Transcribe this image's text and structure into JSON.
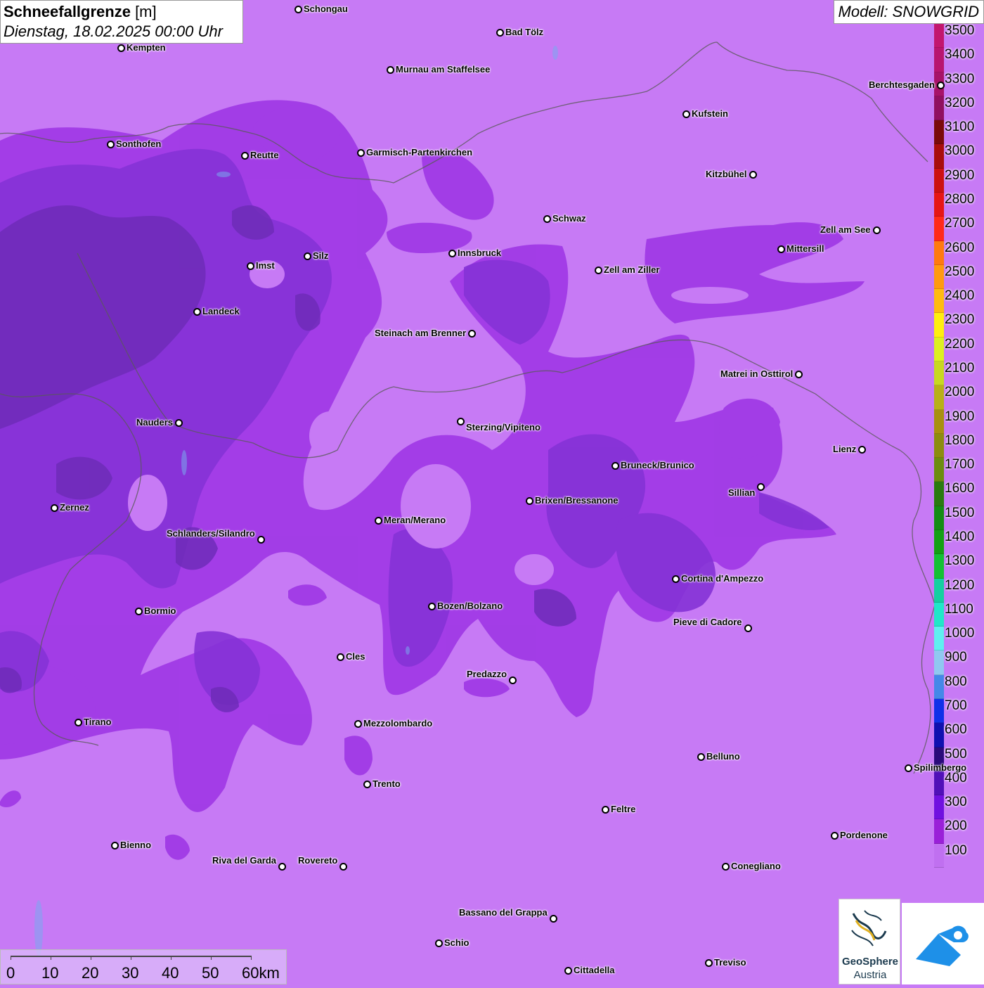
{
  "header": {
    "title_bold": "Schneefallgrenze",
    "title_unit": " [m]",
    "datetime": "Dienstag, 18.02.2025 00:00 Uhr",
    "model": "Modell: SNOWGRID"
  },
  "legend": {
    "labels": [
      "3500",
      "3400",
      "3300",
      "3200",
      "3100",
      "3000",
      "2900",
      "2800",
      "2700",
      "2600",
      "2500",
      "2400",
      "2300",
      "2200",
      "2100",
      "2000",
      "1900",
      "1800",
      "1700",
      "1600",
      "1500",
      "1400",
      "1300",
      "1200",
      "1100",
      "1000",
      "900",
      "800",
      "700",
      "600",
      "500",
      "400",
      "300",
      "200",
      "100"
    ],
    "colors": [
      "#c2166e",
      "#b8156f",
      "#a71368",
      "#901060",
      "#7a0a0a",
      "#a80d0d",
      "#cc1111",
      "#e61616",
      "#ff2a1a",
      "#ff7a10",
      "#ff9a10",
      "#ffbb10",
      "#ffee10",
      "#ddf020",
      "#c8d820",
      "#b8b018",
      "#a89010",
      "#8c8c10",
      "#6c8c10",
      "#2a7a10",
      "#148c14",
      "#14a014",
      "#14c034",
      "#14d0a0",
      "#20e8c8",
      "#60f0f0",
      "#90c8f0",
      "#4488e8",
      "#1030e8",
      "#1010b0",
      "#2a0a7a",
      "#5010b8",
      "#7010e0",
      "#9a20d8",
      "#c070f0"
    ]
  },
  "scale": {
    "labels": [
      "0",
      "10",
      "20",
      "30",
      "40",
      "50",
      "60km"
    ]
  },
  "cities": [
    {
      "name": "Schongau"
    },
    {
      "name": "Bad Tölz"
    },
    {
      "name": "Kempten"
    },
    {
      "name": "Murnau am Staffelsee"
    },
    {
      "name": "Berchtesgaden"
    },
    {
      "name": "Kufstein"
    },
    {
      "name": "Sonthofen"
    },
    {
      "name": "Reutte"
    },
    {
      "name": "Garmisch-Partenkirchen"
    },
    {
      "name": "Kitzbühel"
    },
    {
      "name": "Schwaz"
    },
    {
      "name": "Zell am See"
    },
    {
      "name": "Imst"
    },
    {
      "name": "Silz"
    },
    {
      "name": "Innsbruck"
    },
    {
      "name": "Mittersill"
    },
    {
      "name": "Zell am Ziller"
    },
    {
      "name": "Landeck"
    },
    {
      "name": "Steinach am Brenner"
    },
    {
      "name": "Matrei in Osttirol"
    },
    {
      "name": "Nauders"
    },
    {
      "name": "Sterzing/Vipiteno"
    },
    {
      "name": "Lienz"
    },
    {
      "name": "Bruneck/Brunico"
    },
    {
      "name": "Sillian"
    },
    {
      "name": "Zernez"
    },
    {
      "name": "Brixen/Bressanone"
    },
    {
      "name": "Meran/Merano"
    },
    {
      "name": "Schlanders/Silandro"
    },
    {
      "name": "Cortina d'Ampezzo"
    },
    {
      "name": "Bormio"
    },
    {
      "name": "Bozen/Bolzano"
    },
    {
      "name": "Pieve di Cadore"
    },
    {
      "name": "Cles"
    },
    {
      "name": "Predazzo"
    },
    {
      "name": "Tirano"
    },
    {
      "name": "Mezzolombardo"
    },
    {
      "name": "Belluno"
    },
    {
      "name": "Spilimbergo"
    },
    {
      "name": "Trento"
    },
    {
      "name": "Feltre"
    },
    {
      "name": "Pordenone"
    },
    {
      "name": "Bienno"
    },
    {
      "name": "Riva del Garda"
    },
    {
      "name": "Rovereto"
    },
    {
      "name": "Conegliano"
    },
    {
      "name": "Bassano del Grappa"
    },
    {
      "name": "Schio"
    },
    {
      "name": "Treviso"
    },
    {
      "name": "Cittadella"
    }
  ],
  "logos": {
    "geosphere_line1": "GeoSphere",
    "geosphere_line2": "Austria"
  },
  "colors": {
    "base_snowline": "#c77af5",
    "mid_snowline": "#9a3ae8",
    "high_snowline": "#7a2ad0",
    "highest_snowline": "#6a2ab8"
  }
}
